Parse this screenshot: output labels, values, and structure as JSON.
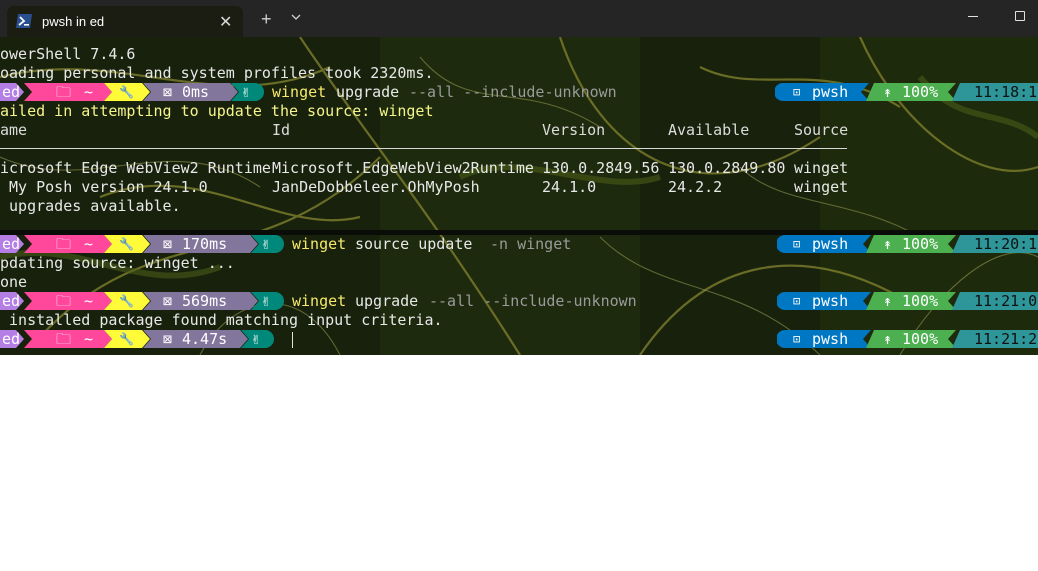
{
  "titlebar": {
    "tab_title": "pwsh in ed",
    "close_glyph": "✕",
    "new_tab_glyph": "+",
    "icons": [
      "powershell-icon",
      "close-icon",
      "plus-icon",
      "chevron-down-icon",
      "minimize-icon",
      "maximize-icon"
    ]
  },
  "terminal": {
    "header": [
      "owerShell 7.4.6",
      "oading personal and system profiles took 2320ms."
    ],
    "prompt_segments": {
      "user": "ed",
      "folder_icon": "🗀",
      "path": "~",
      "git_icon": "🔧",
      "duration_icon": "⊠",
      "status_icon": "✌"
    },
    "prompts": [
      {
        "duration": "0ms",
        "command": "winget",
        "args": "upgrade",
        "flags": "--all --include-unknown",
        "shell": "pwsh",
        "battery": "100%",
        "time": "11:18:1"
      },
      {
        "duration": "170ms",
        "command": "winget",
        "args": "source update",
        "flags": "-n winget",
        "shell": "pwsh",
        "battery": "100%",
        "time": "11:20:1"
      },
      {
        "duration": "569ms",
        "command": "winget",
        "args": "upgrade",
        "flags": "--all --include-unknown",
        "shell": "pwsh",
        "battery": "100%",
        "time": "11:21:0"
      },
      {
        "duration": "4.47s",
        "command": "",
        "args": "",
        "flags": "",
        "shell": "pwsh",
        "battery": "100%",
        "time": "11:21:2"
      }
    ],
    "failed_msg": "ailed in attempting to update the source: winget",
    "table": {
      "headers": [
        "ame",
        "Id",
        "Version",
        "Available",
        "Source"
      ],
      "rows": [
        [
          "icrosoft Edge WebView2 Runtime",
          "Microsoft.EdgeWebView2Runtime",
          "130.0.2849.56",
          "130.0.2849.80",
          "winget"
        ],
        [
          " My Posh version 24.1.0",
          "JanDeDobbeleer.OhMyPosh",
          "24.1.0",
          "24.2.2",
          "winget"
        ]
      ],
      "footer": " upgrades available."
    },
    "updating_msg": "pdating source: winget ...",
    "done_msg": "one",
    "no_package_msg": " installed package found matching input criteria.",
    "colors": {
      "user": "#b47ee5",
      "path": "#ff479c",
      "git": "#fffb38",
      "duration": "#83769c",
      "status": "#00897b",
      "shell": "#0077c2",
      "battery": "#4caf50",
      "time": "#2e9599"
    }
  }
}
